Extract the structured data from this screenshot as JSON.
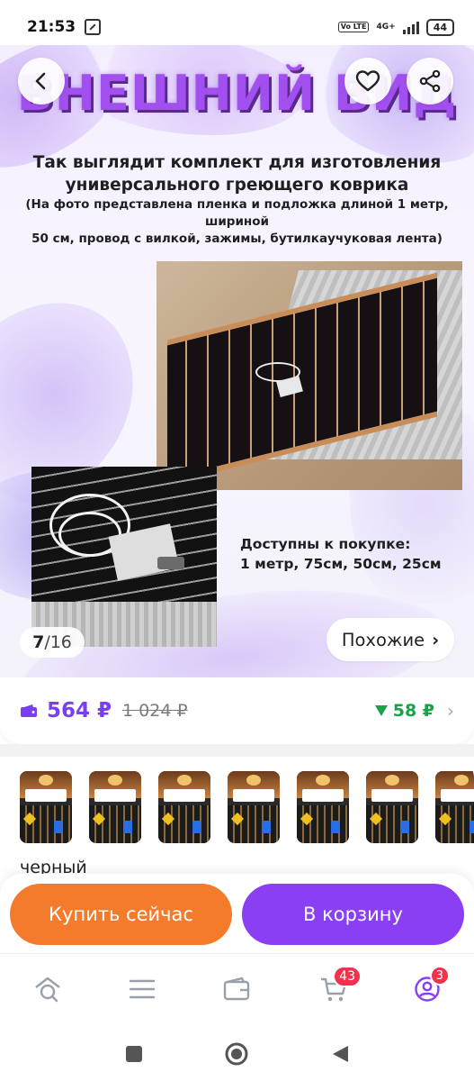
{
  "status_bar": {
    "time": "21:53",
    "volte": "Vo LTE",
    "network": "4G+",
    "battery": "44"
  },
  "hero": {
    "heading": "ВНЕШНИЙ ВИД",
    "subtitle_line1": "Так выглядит комплект для изготовления",
    "subtitle_line2": "универсального греющего коврика",
    "note_line1": "(На фото представлена пленка и подложка длиной 1 метр, шириной",
    "note_line2": "50 см, провод с вилкой, зажимы, бутилкаучуковая лента)",
    "availability_line1": "Доступны  к покупке:",
    "availability_line2": "1 метр, 75см, 50см, 25см",
    "image_counter": {
      "current": "7",
      "separator": "/",
      "total": "16"
    },
    "similar_button": "Похожие",
    "similar_chevron": "›"
  },
  "price": {
    "current": "564 ₽",
    "old": "1 024 ₽",
    "discount": "58 ₽",
    "chevron": "›",
    "accent_color": "#7a3ff0",
    "discount_color": "#17a34a"
  },
  "variants": {
    "thumbnails": [
      {
        "icon": "heating-film-pack"
      },
      {
        "icon": "heating-film-pack"
      },
      {
        "icon": "heating-film-pack"
      },
      {
        "icon": "heating-film-pack"
      },
      {
        "icon": "heating-film-pack"
      },
      {
        "icon": "heating-film-pack"
      },
      {
        "icon": "heating-film-pack"
      }
    ],
    "selected_label": "черный"
  },
  "actions": {
    "buy_now": "Купить сейчас",
    "add_to_cart": "В корзину",
    "buy_now_color": "#f47b2c",
    "add_to_cart_color": "#8a3ff2"
  },
  "bottom_nav": {
    "items": [
      {
        "icon": "search-home-icon"
      },
      {
        "icon": "catalog-icon"
      },
      {
        "icon": "wallet-icon"
      },
      {
        "icon": "cart-icon",
        "badge": "43"
      },
      {
        "icon": "profile-icon",
        "badge": "3"
      }
    ]
  }
}
